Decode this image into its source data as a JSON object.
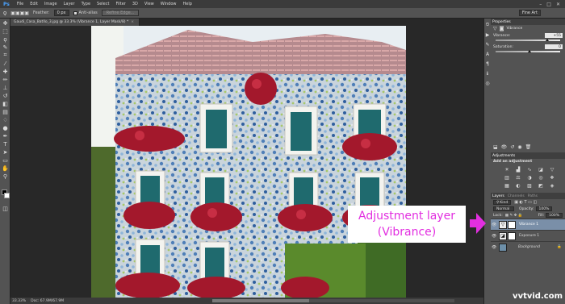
{
  "app": {
    "logo": "Ps"
  },
  "menu": [
    "File",
    "Edit",
    "Image",
    "Layer",
    "Type",
    "Select",
    "Filter",
    "3D",
    "View",
    "Window",
    "Help"
  ],
  "options": {
    "feather_label": "Feather:",
    "feather_value": "0 px",
    "antialias_label": "Anti-alias",
    "refine_button": "Refine Edge...",
    "workspace": "Fine Art"
  },
  "document": {
    "tab_title": "Gaudi_Casa_Batllo_3.jpg @ 33.3% (Vibrance 1, Layer Mask/8) *",
    "zoom": "33.33%",
    "doc_info": "Doc: 67.9M/67.9M"
  },
  "properties": {
    "tab": "Properties",
    "header": "Vibrance",
    "vibrance_label": "Vibrance:",
    "vibrance_value": "+55",
    "vibrance_pct": 0.77,
    "saturation_label": "Saturation:",
    "saturation_value": "0",
    "saturation_pct": 0.5
  },
  "adjustments": {
    "tab": "Adjustments",
    "title": "Add an adjustment",
    "icons": [
      "brightness-contrast-icon",
      "levels-icon",
      "curves-icon",
      "exposure-icon",
      "vibrance-icon",
      "hue-saturation-icon",
      "color-balance-icon",
      "black-white-icon",
      "photo-filter-icon",
      "channel-mixer-icon",
      "color-lookup-icon",
      "invert-icon",
      "posterize-icon",
      "threshold-icon",
      "selective-color-icon"
    ]
  },
  "layers_panel": {
    "tabs": [
      "Layers",
      "Channels",
      "Paths"
    ],
    "kind_label": "Kind",
    "blend_mode": "Normal",
    "opacity_label": "Opacity:",
    "opacity_value": "100%",
    "lock_label": "Lock:",
    "fill_label": "Fill:",
    "fill_value": "100%",
    "layers": [
      {
        "name": "Vibrance 1",
        "selected": true
      },
      {
        "name": "Exposure 1",
        "selected": false
      },
      {
        "name": "Background",
        "selected": false
      }
    ]
  },
  "annotation": {
    "line1": "Adjustment layer",
    "line2": "(Vibrance)",
    "color": "#e22fe0"
  },
  "watermark": "vvtvid.com",
  "colors": {
    "ui_dark": "#282828",
    "panel": "#535353",
    "selected_layer": "#7a8fa8"
  }
}
